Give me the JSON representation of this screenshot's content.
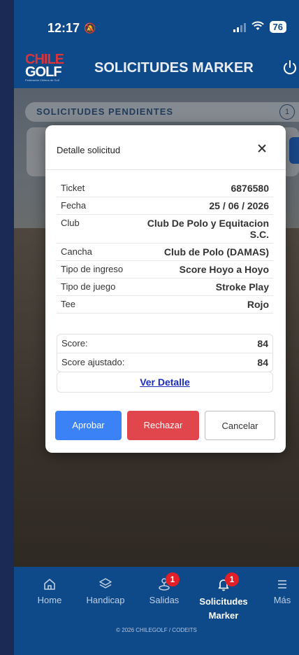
{
  "status_bar": {
    "time": "12:17",
    "battery": "76"
  },
  "header": {
    "logo_line1": "CHILE",
    "logo_line2": "GOLF",
    "logo_tagline": "Federación Chilena de Golf",
    "title": "SOLICITUDES MARKER"
  },
  "background": {
    "section_label": "SOLICITUDES PENDIENTES",
    "section_count": "1"
  },
  "modal": {
    "title": "Detalle solicitud",
    "rows": [
      {
        "label": "Ticket",
        "value": "6876580"
      },
      {
        "label": "Fecha",
        "value": "25 / 06 / 2026"
      },
      {
        "label": "Club",
        "value": "Club De Polo y Equitacion S.C."
      },
      {
        "label": "Cancha",
        "value": "Club de Polo (DAMAS)"
      },
      {
        "label": "Tipo de ingreso",
        "value": "Score Hoyo a Hoyo"
      },
      {
        "label": "Tipo de juego",
        "value": "Stroke Play"
      },
      {
        "label": "Tee",
        "value": "Rojo"
      }
    ],
    "score": {
      "label": "Score:",
      "value": "84"
    },
    "score_adjusted": {
      "label": "Score ajustado:",
      "value": "84"
    },
    "detail_link": "Ver Detalle",
    "approve_label": "Aprobar",
    "reject_label": "Rechazar",
    "cancel_label": "Cancelar"
  },
  "nav": {
    "items": [
      {
        "label": "Home",
        "icon": "home-icon"
      },
      {
        "label": "Handicap",
        "icon": "layers-icon"
      },
      {
        "label": "Salidas",
        "icon": "golf-icon",
        "badge": "1"
      },
      {
        "label": "Solicitudes",
        "label2": "Marker",
        "icon": "bell-icon",
        "badge": "1",
        "active": true
      },
      {
        "label": "Más",
        "icon": "menu-icon"
      }
    ],
    "copyright": "© 2026 CHILEGOLF / CODEITS"
  },
  "colors": {
    "primary": "#0e4a8a",
    "approve": "#3b82f6",
    "reject": "#e0464b",
    "badge": "#e21f26",
    "link": "#1a2cc0"
  }
}
